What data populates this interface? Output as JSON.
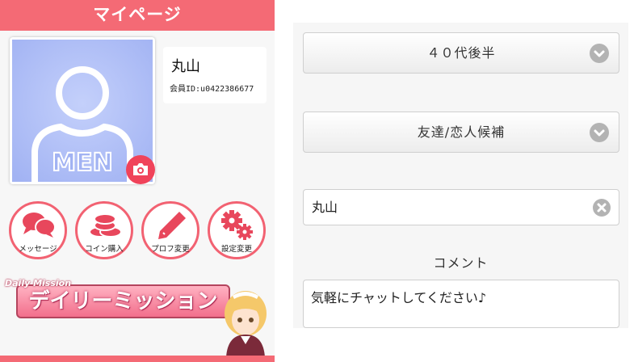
{
  "header": {
    "title": "マイページ"
  },
  "profile": {
    "name": "丸山",
    "member_id": "会員ID:u0422386677",
    "avatar_text": "MEN"
  },
  "menu": [
    {
      "label": "メッセージ",
      "icon": "message-icon"
    },
    {
      "label": "コイン購入",
      "icon": "coin-icon"
    },
    {
      "label": "プロフ変更",
      "icon": "pencil-icon"
    },
    {
      "label": "設定変更",
      "icon": "gear-icon"
    }
  ],
  "banner": {
    "small_text": "Daily Mission",
    "title": "デイリーミッション"
  },
  "form": {
    "age_select": "４０代後半",
    "purpose_select": "友達/恋人候補",
    "name_value": "丸山",
    "comment_label": "コメント",
    "comment_value": "気軽にチャットしてください♪"
  },
  "colors": {
    "accent": "#f46a75",
    "avatar_bg": "#a9b9f5",
    "select_icon": "#b3b3b3"
  }
}
